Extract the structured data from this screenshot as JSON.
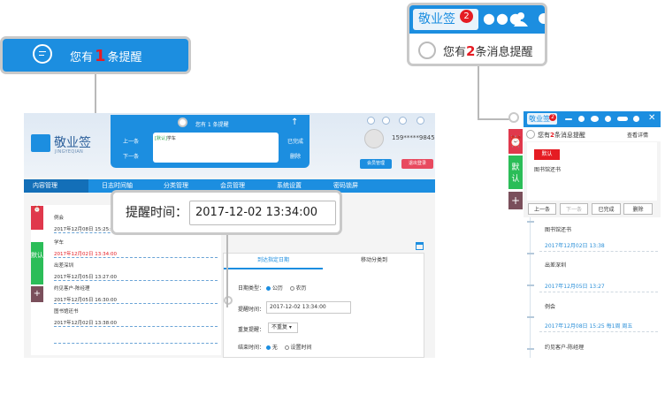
{
  "callout_left": {
    "prefix": "您有",
    "count": "1",
    "suffix": "条提醒"
  },
  "callout_right": {
    "tab": "敬业签",
    "badge": "2",
    "prefix": "您有",
    "count": "2",
    "suffix": "条消息提醒"
  },
  "app": {
    "logo": {
      "name": "敬业签",
      "sub": "JINGYEQIAN"
    },
    "reminder_panel": {
      "title_prefix": "您有 ",
      "title_count": "1",
      "title_suffix": " 条提醒",
      "prev": "上一条",
      "next": "下一条",
      "done": "已完成",
      "delete": "删除",
      "memo_tag": "[默认]",
      "memo_text": "学车"
    },
    "phone": "159*****9845",
    "member_btn": "会员管理",
    "logout_btn": "退出登录",
    "nav": [
      "内容管理",
      "日志时间轴",
      "分类管理",
      "会员管理",
      "系统设置",
      "密码锁屏"
    ],
    "side_tabs": {
      "default": "默认"
    },
    "list": [
      {
        "title": "例会",
        "date": "2017年12月08日 15:25:00 周五"
      },
      {
        "title": "学车",
        "date": "2017年12月02日 13:34:00"
      },
      {
        "title": "出差深圳",
        "date": "2017年12月05日 13:27:00"
      },
      {
        "title": "约见客户-陈经理",
        "date": "2017年12月05日 16:30:00"
      },
      {
        "title": "图书馆还书",
        "date": "2017年12月02日 13:38:00"
      }
    ],
    "form": {
      "tab_active": "到达指定日期",
      "tab_other": "移动分类到",
      "date_type_label": "日期类型：",
      "opt_solar": "公历",
      "opt_lunar": "农历",
      "remind_label": "提醒时间：",
      "remind_value": "2017-12-02 13:34:00",
      "repeat_label": "重复提醒：",
      "repeat_value": "不重复",
      "end_label": "结束时间：",
      "end_none": "无",
      "end_set": "设置时间"
    }
  },
  "zoom": {
    "label": "提醒时间：",
    "value": "2017-12-02 13:34:00"
  },
  "widget": {
    "tab": "敬业签",
    "badge": "2",
    "head_prefix": "您有",
    "head_count": "2",
    "head_suffix": "条消息提醒",
    "detail_btn": "查看详情",
    "tag": "默认",
    "memo": "图书馆还书",
    "btn_prev": "上一条",
    "btn_next": "下一条",
    "btn_done": "已完成",
    "btn_delete": "删除",
    "side_default": "默认",
    "list": [
      {
        "title": "图书馆还书",
        "date": "2017年12月02日 13:38"
      },
      {
        "title": "出差深圳",
        "date": "2017年12月05日 13:27"
      },
      {
        "title": "例会",
        "date": "2017年12月08日 15:25 每1周 周五"
      },
      {
        "title": "约见客户-陈经理",
        "date": ""
      }
    ]
  },
  "colors": {
    "brand": "#1c8ee0",
    "alert_red": "#e51c23",
    "side_green": "#2bbd58",
    "side_red": "#e0384c",
    "side_dark": "#7a4f5b"
  }
}
